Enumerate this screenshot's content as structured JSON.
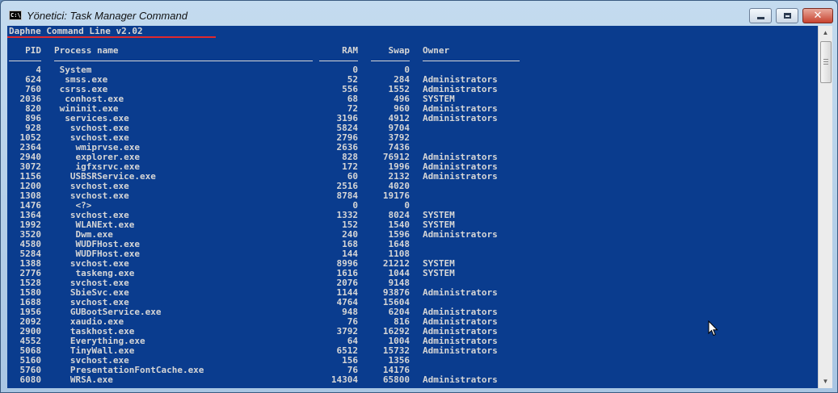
{
  "window": {
    "title": "Yönetici: Task Manager Command",
    "icon": "console-app-icon"
  },
  "console": {
    "banner": "Daphne Command Line v2.02",
    "headers": {
      "pid": "PID",
      "name": "Process name",
      "ram": "RAM",
      "swap": "Swap",
      "owner": "Owner"
    },
    "rows": [
      {
        "pid": "4",
        "name": " System",
        "ram": "0",
        "swap": "0",
        "owner": ""
      },
      {
        "pid": "624",
        "name": "  smss.exe",
        "ram": "52",
        "swap": "284",
        "owner": "Administrators"
      },
      {
        "pid": "760",
        "name": " csrss.exe",
        "ram": "556",
        "swap": "1552",
        "owner": "Administrators"
      },
      {
        "pid": "2036",
        "name": "  conhost.exe",
        "ram": "68",
        "swap": "496",
        "owner": "SYSTEM"
      },
      {
        "pid": "820",
        "name": " wininit.exe",
        "ram": "72",
        "swap": "960",
        "owner": "Administrators"
      },
      {
        "pid": "896",
        "name": "  services.exe",
        "ram": "3196",
        "swap": "4912",
        "owner": "Administrators"
      },
      {
        "pid": "928",
        "name": "   svchost.exe",
        "ram": "5824",
        "swap": "9704",
        "owner": ""
      },
      {
        "pid": "1052",
        "name": "   svchost.exe",
        "ram": "2796",
        "swap": "3792",
        "owner": ""
      },
      {
        "pid": "2364",
        "name": "    wmiprvse.exe",
        "ram": "2636",
        "swap": "7436",
        "owner": ""
      },
      {
        "pid": "2940",
        "name": "    explorer.exe",
        "ram": "828",
        "swap": "76912",
        "owner": "Administrators"
      },
      {
        "pid": "3072",
        "name": "    igfxsrvc.exe",
        "ram": "172",
        "swap": "1996",
        "owner": "Administrators"
      },
      {
        "pid": "1156",
        "name": "   USBSRService.exe",
        "ram": "60",
        "swap": "2132",
        "owner": "Administrators"
      },
      {
        "pid": "1200",
        "name": "   svchost.exe",
        "ram": "2516",
        "swap": "4020",
        "owner": ""
      },
      {
        "pid": "1308",
        "name": "   svchost.exe",
        "ram": "8784",
        "swap": "19176",
        "owner": ""
      },
      {
        "pid": "1476",
        "name": "    <?>",
        "ram": "0",
        "swap": "0",
        "owner": ""
      },
      {
        "pid": "1364",
        "name": "   svchost.exe",
        "ram": "1332",
        "swap": "8024",
        "owner": "SYSTEM"
      },
      {
        "pid": "1992",
        "name": "    WLANExt.exe",
        "ram": "152",
        "swap": "1540",
        "owner": "SYSTEM"
      },
      {
        "pid": "3520",
        "name": "    Dwm.exe",
        "ram": "240",
        "swap": "1596",
        "owner": "Administrators"
      },
      {
        "pid": "4580",
        "name": "    WUDFHost.exe",
        "ram": "168",
        "swap": "1648",
        "owner": ""
      },
      {
        "pid": "5284",
        "name": "    WUDFHost.exe",
        "ram": "144",
        "swap": "1108",
        "owner": ""
      },
      {
        "pid": "1388",
        "name": "   svchost.exe",
        "ram": "8996",
        "swap": "21212",
        "owner": "SYSTEM"
      },
      {
        "pid": "2776",
        "name": "    taskeng.exe",
        "ram": "1616",
        "swap": "1044",
        "owner": "SYSTEM"
      },
      {
        "pid": "1528",
        "name": "   svchost.exe",
        "ram": "2076",
        "swap": "9148",
        "owner": ""
      },
      {
        "pid": "1580",
        "name": "   SbieSvc.exe",
        "ram": "1144",
        "swap": "93876",
        "owner": "Administrators"
      },
      {
        "pid": "1688",
        "name": "   svchost.exe",
        "ram": "4764",
        "swap": "15604",
        "owner": ""
      },
      {
        "pid": "1956",
        "name": "   GUBootService.exe",
        "ram": "948",
        "swap": "6204",
        "owner": "Administrators"
      },
      {
        "pid": "2092",
        "name": "   xaudio.exe",
        "ram": "76",
        "swap": "816",
        "owner": "Administrators"
      },
      {
        "pid": "2900",
        "name": "   taskhost.exe",
        "ram": "3792",
        "swap": "16292",
        "owner": "Administrators"
      },
      {
        "pid": "4552",
        "name": "   Everything.exe",
        "ram": "64",
        "swap": "1004",
        "owner": "Administrators"
      },
      {
        "pid": "5068",
        "name": "   TinyWall.exe",
        "ram": "6512",
        "swap": "15732",
        "owner": "Administrators"
      },
      {
        "pid": "5160",
        "name": "   svchost.exe",
        "ram": "156",
        "swap": "1356",
        "owner": ""
      },
      {
        "pid": "5760",
        "name": "   PresentationFontCache.exe",
        "ram": "76",
        "swap": "14176",
        "owner": ""
      },
      {
        "pid": "6080",
        "name": "   WRSA.exe",
        "ram": "14304",
        "swap": "65800",
        "owner": "Administrators"
      }
    ]
  },
  "colors": {
    "console_bg": "#0a3c8e",
    "console_text": "#d6d6d6",
    "highlight_underline": "#e0282d"
  }
}
